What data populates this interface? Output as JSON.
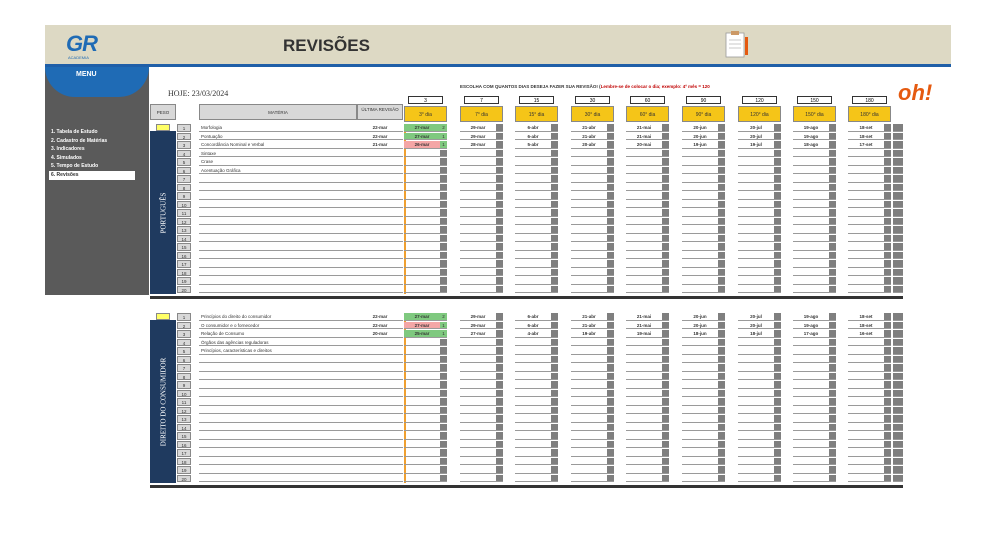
{
  "header": {
    "logo": "GR",
    "logo_sub": "ACADEMIA",
    "title": "REVISÕES"
  },
  "sidebar": {
    "menu_label": "MENU",
    "items": [
      {
        "label": "1. Tabela de Estudo"
      },
      {
        "label": "2. Cadastro de Matérias"
      },
      {
        "label": "3. Indicadores"
      },
      {
        "label": "4. Simulados"
      },
      {
        "label": "5. Tempo de Estudo"
      },
      {
        "label": "6. Revisões"
      }
    ]
  },
  "hoje": "HOJE:   23/03/2024",
  "escolha": {
    "text": "ESCOLHA COM QUANTOS DIAS DESEJA FAZER SUA REVISÃO! (",
    "red": "Lembre-se de colocar o dia; exemplo: 4º mês = 120"
  },
  "logo_right": "oh!",
  "columns": {
    "peso": "PESO",
    "materia": "MATÉRIA",
    "ultima": "ÚLTIMA REVISÃO"
  },
  "day_inputs": [
    "3",
    "7",
    "15",
    "30",
    "60",
    "90",
    "120",
    "150",
    "180"
  ],
  "day_headers": [
    "3° dia",
    "7° dia",
    "15° dia",
    "30° dia",
    "60° dia",
    "90° dia",
    "120° dia",
    "150° dia",
    "180° dia"
  ],
  "sections": [
    {
      "label": "PORTUGUÊS",
      "rows": [
        {
          "n": "1",
          "materia": "Morfologia",
          "ultima": "22-mar",
          "d": [
            "27-mar",
            "29-mar",
            "6-abr",
            "21-abr",
            "21-mai",
            "20-jun",
            "20-jul",
            "19-ago",
            "18-set"
          ],
          "s": "2"
        },
        {
          "n": "2",
          "materia": "Pontuação",
          "ultima": "22-mar",
          "d": [
            "27-mar",
            "29-mar",
            "6-abr",
            "21-abr",
            "21-mai",
            "20-jun",
            "20-jul",
            "19-ago",
            "18-set"
          ],
          "s": "1"
        },
        {
          "n": "3",
          "materia": "Concordância Nominal e Verbal",
          "ultima": "21-mar",
          "d": [
            "26-mar",
            "28-mar",
            "5-abr",
            "20-abr",
            "20-mai",
            "19-jun",
            "19-jul",
            "18-ago",
            "17-set"
          ],
          "s": "1"
        },
        {
          "n": "4",
          "materia": "Sintaxe",
          "ultima": "",
          "d": [],
          "s": ""
        },
        {
          "n": "5",
          "materia": "Crase",
          "ultima": "",
          "d": [],
          "s": ""
        },
        {
          "n": "6",
          "materia": "Acentuação Gráfica",
          "ultima": "",
          "d": [],
          "s": ""
        },
        {
          "n": "7",
          "materia": "",
          "ultima": "",
          "d": [],
          "s": ""
        },
        {
          "n": "8",
          "materia": "",
          "ultima": "",
          "d": [],
          "s": ""
        },
        {
          "n": "9",
          "materia": "",
          "ultima": "",
          "d": [],
          "s": ""
        },
        {
          "n": "10",
          "materia": "",
          "ultima": "",
          "d": [],
          "s": ""
        },
        {
          "n": "11",
          "materia": "",
          "ultima": "",
          "d": [],
          "s": ""
        },
        {
          "n": "12",
          "materia": "",
          "ultima": "",
          "d": [],
          "s": ""
        },
        {
          "n": "13",
          "materia": "",
          "ultima": "",
          "d": [],
          "s": ""
        },
        {
          "n": "14",
          "materia": "",
          "ultima": "",
          "d": [],
          "s": ""
        },
        {
          "n": "15",
          "materia": "",
          "ultima": "",
          "d": [],
          "s": ""
        },
        {
          "n": "16",
          "materia": "",
          "ultima": "",
          "d": [],
          "s": ""
        },
        {
          "n": "17",
          "materia": "",
          "ultima": "",
          "d": [],
          "s": ""
        },
        {
          "n": "18",
          "materia": "",
          "ultima": "",
          "d": [],
          "s": ""
        },
        {
          "n": "19",
          "materia": "",
          "ultima": "",
          "d": [],
          "s": ""
        },
        {
          "n": "20",
          "materia": "",
          "ultima": "",
          "d": [],
          "s": ""
        }
      ],
      "colors": [
        "#7fc97f",
        "#7fc97f",
        "#f4a6a6"
      ]
    },
    {
      "label": "DIREITO DO CONSUMIDOR",
      "rows": [
        {
          "n": "1",
          "materia": "Princípios do direito do consumidor",
          "ultima": "22-mar",
          "d": [
            "27-mar",
            "29-mar",
            "6-abr",
            "21-abr",
            "21-mai",
            "20-jun",
            "20-jul",
            "19-ago",
            "18-set"
          ],
          "s": "2"
        },
        {
          "n": "2",
          "materia": "O consumidor e o fornecedor",
          "ultima": "22-mar",
          "d": [
            "27-mar",
            "29-mar",
            "6-abr",
            "21-abr",
            "21-mai",
            "20-jun",
            "20-jul",
            "19-ago",
            "18-set"
          ],
          "s": "1"
        },
        {
          "n": "3",
          "materia": "Relação de Consumo",
          "ultima": "20-mar",
          "d": [
            "25-mar",
            "27-mar",
            "4-abr",
            "19-abr",
            "19-mai",
            "18-jun",
            "18-jul",
            "17-ago",
            "16-set"
          ],
          "s": "1"
        },
        {
          "n": "4",
          "materia": "Órgãos das agências reguladoras",
          "ultima": "",
          "d": [],
          "s": ""
        },
        {
          "n": "5",
          "materia": "Princípios, características e direitos",
          "ultima": "",
          "d": [],
          "s": ""
        },
        {
          "n": "6",
          "materia": "",
          "ultima": "",
          "d": [],
          "s": ""
        },
        {
          "n": "7",
          "materia": "",
          "ultima": "",
          "d": [],
          "s": ""
        },
        {
          "n": "8",
          "materia": "",
          "ultima": "",
          "d": [],
          "s": ""
        },
        {
          "n": "9",
          "materia": "",
          "ultima": "",
          "d": [],
          "s": ""
        },
        {
          "n": "10",
          "materia": "",
          "ultima": "",
          "d": [],
          "s": ""
        },
        {
          "n": "11",
          "materia": "",
          "ultima": "",
          "d": [],
          "s": ""
        },
        {
          "n": "12",
          "materia": "",
          "ultima": "",
          "d": [],
          "s": ""
        },
        {
          "n": "13",
          "materia": "",
          "ultima": "",
          "d": [],
          "s": ""
        },
        {
          "n": "14",
          "materia": "",
          "ultima": "",
          "d": [],
          "s": ""
        },
        {
          "n": "15",
          "materia": "",
          "ultima": "",
          "d": [],
          "s": ""
        },
        {
          "n": "16",
          "materia": "",
          "ultima": "",
          "d": [],
          "s": ""
        },
        {
          "n": "17",
          "materia": "",
          "ultima": "",
          "d": [],
          "s": ""
        },
        {
          "n": "18",
          "materia": "",
          "ultima": "",
          "d": [],
          "s": ""
        },
        {
          "n": "19",
          "materia": "",
          "ultima": "",
          "d": [],
          "s": ""
        },
        {
          "n": "20",
          "materia": "",
          "ultima": "",
          "d": [],
          "s": ""
        }
      ],
      "colors": [
        "#7fc97f",
        "#f4a6a6",
        "#7fc97f"
      ]
    }
  ]
}
